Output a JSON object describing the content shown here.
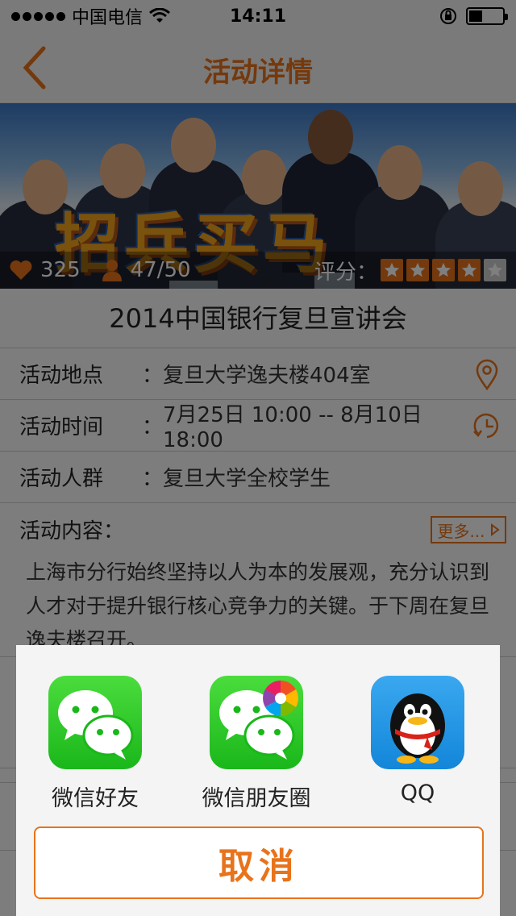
{
  "status_bar": {
    "carrier": "中国电信",
    "time": "14:11"
  },
  "nav": {
    "title": "活动详情"
  },
  "banner": {
    "overlay_text": "招兵买马",
    "likes": "325",
    "participants": "47/50",
    "rating_label": "评分：",
    "rating": 4,
    "rating_max": 5
  },
  "activity": {
    "title": "2014中国银行复旦宣讲会",
    "rows": [
      {
        "label": "活动地点",
        "sep": "：",
        "value": "复旦大学逸夫楼404室",
        "icon": "location-pin-icon"
      },
      {
        "label": "活动时间",
        "sep": "：",
        "value": "7月25日 10:00 -- 8月10日 18:00",
        "icon": "clock-icon"
      },
      {
        "label": "活动人群",
        "sep": "：",
        "value": "复旦大学全校学生",
        "icon": ""
      }
    ],
    "content_label": "活动内容：",
    "more_label": "更多...",
    "content_text": "上海市分行始终坚持以人为本的发展观，充分认识到人才对于提升银行核心竞争力的关键。于下周在复旦逸夫楼召开。"
  },
  "share_sheet": {
    "items": [
      {
        "label": "微信好友",
        "icon": "wechat-icon"
      },
      {
        "label": "微信朋友圈",
        "icon": "wechat-moments-icon"
      },
      {
        "label": "QQ",
        "icon": "qq-penguin-icon"
      }
    ],
    "cancel_label": "取消"
  },
  "colors": {
    "accent": "#e8731b",
    "wechat_green": "#1ab71a",
    "qq_blue": "#1386d9"
  }
}
